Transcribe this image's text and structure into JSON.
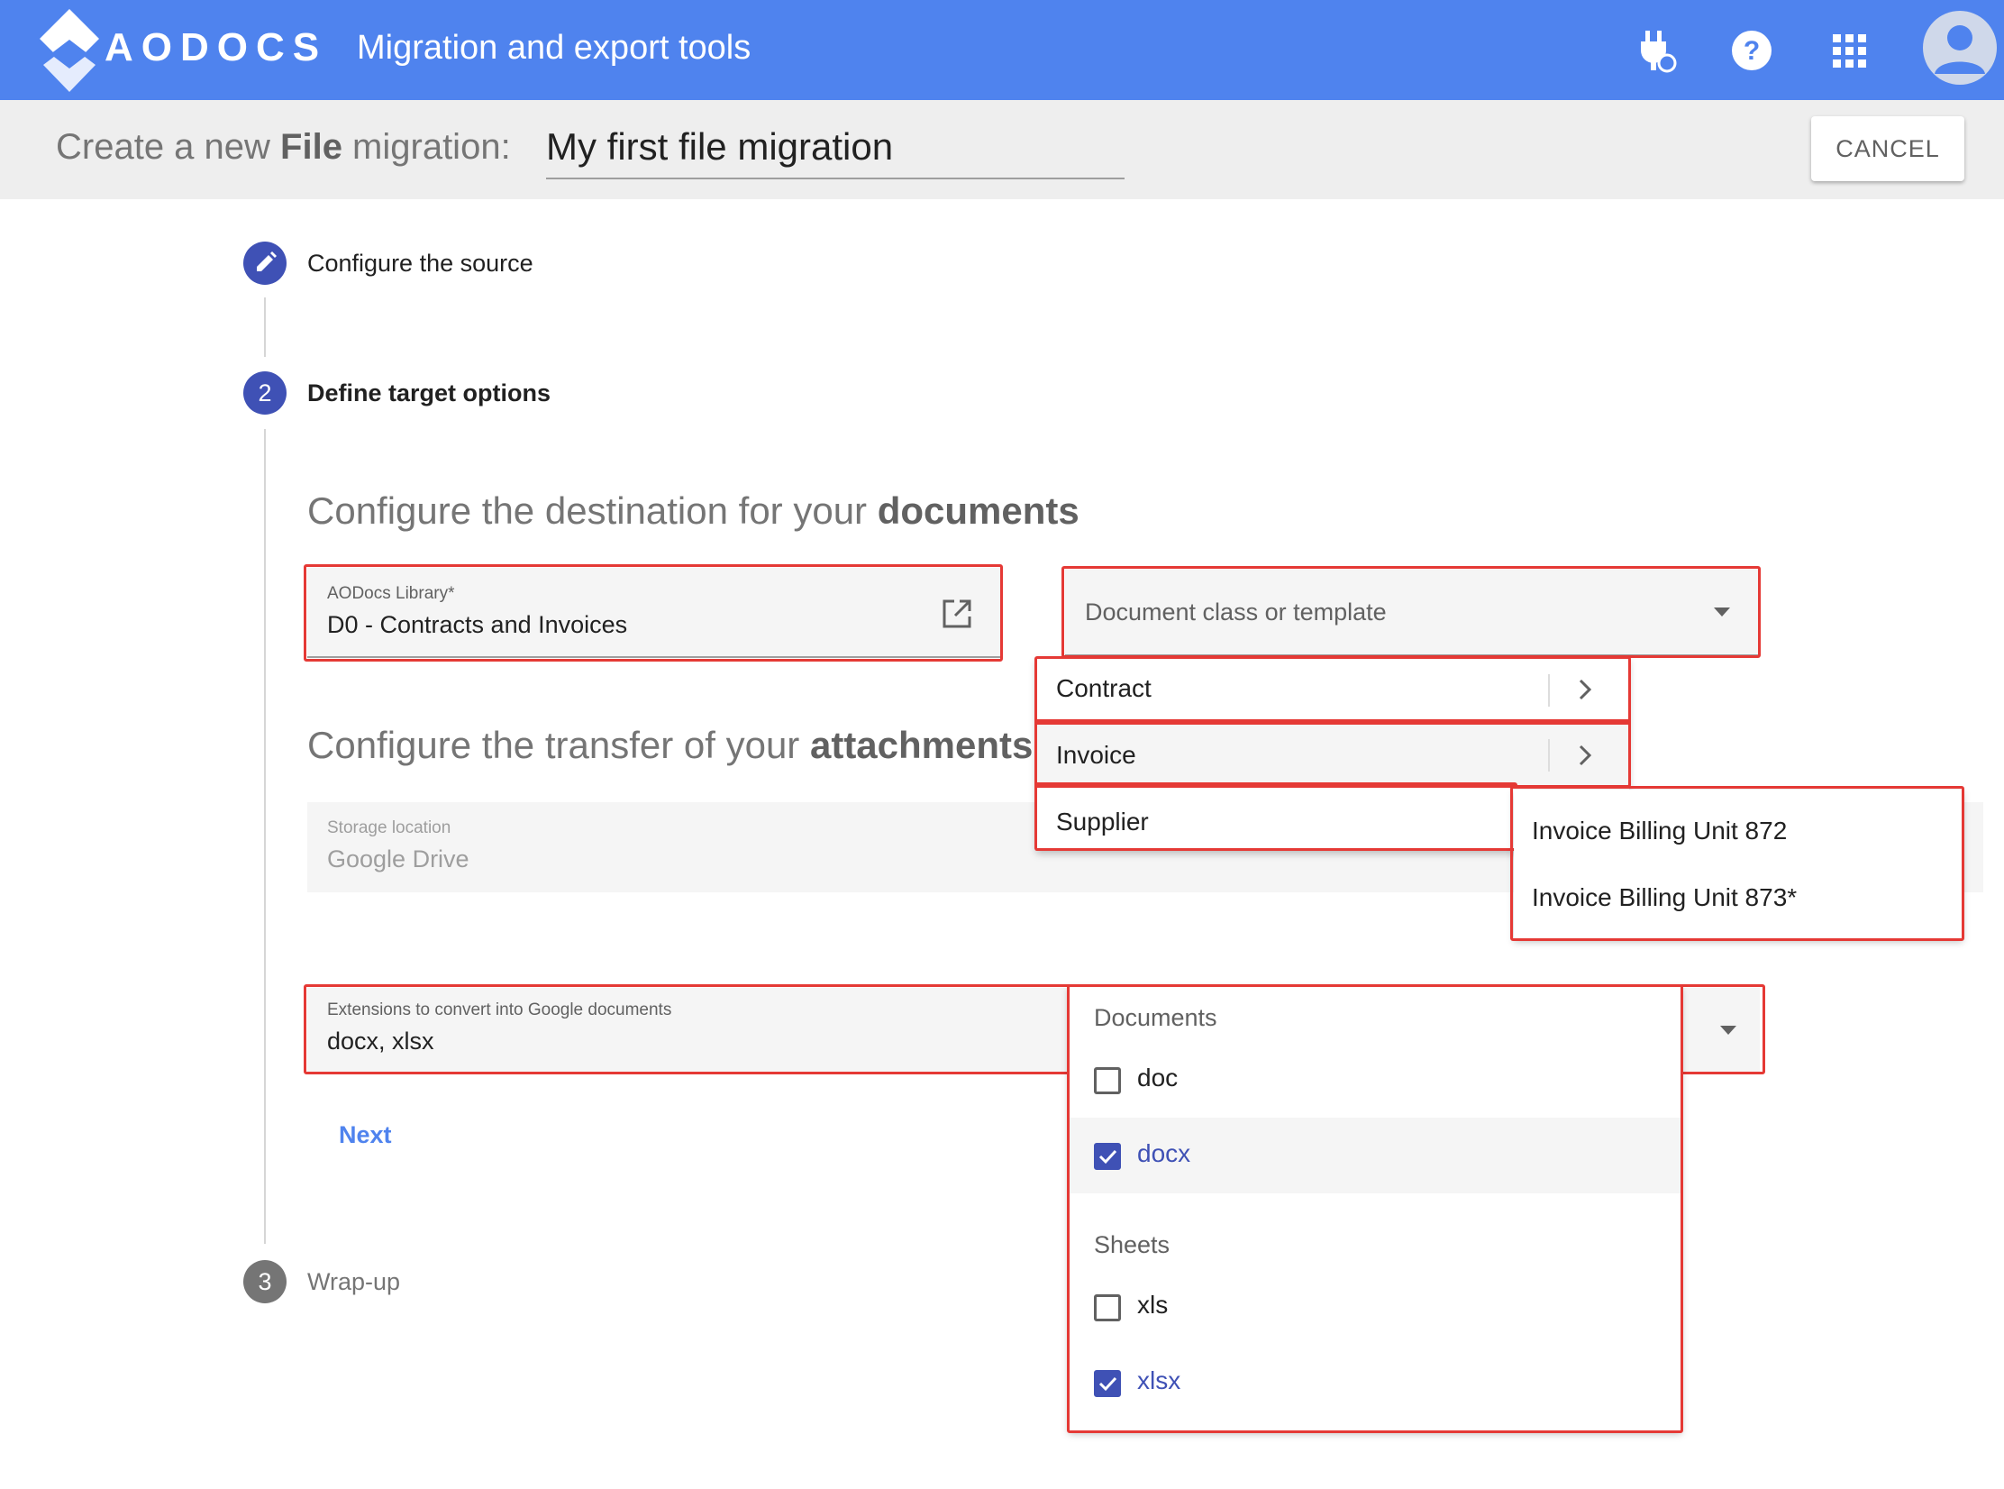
{
  "appbar": {
    "logo_text": "AODOCS",
    "title": "Migration and export tools",
    "icons": [
      "plug-refresh-icon",
      "help-icon",
      "apps-grid-icon",
      "account-avatar-icon"
    ]
  },
  "subbar": {
    "label_prefix": "Create a new ",
    "label_bold": "File",
    "label_suffix": " migration:",
    "migration_name": "My first file migration",
    "cancel": "CANCEL"
  },
  "stepper": {
    "steps": [
      {
        "number": "",
        "label": "Configure the source",
        "state": "edit"
      },
      {
        "number": "2",
        "label": "Define target options",
        "state": "active"
      },
      {
        "number": "3",
        "label": "Wrap-up",
        "state": "inactive"
      }
    ]
  },
  "documents": {
    "title_prefix": "Configure the destination for your ",
    "title_bold": "documents",
    "library_label": "AODocs Library*",
    "library_value": "D0 - Contracts and Invoices",
    "class_placeholder": "Document class or template",
    "class_menu": [
      "Contract",
      "Invoice",
      "Supplier"
    ],
    "invoice_submenu": [
      "Invoice Billing Unit 872",
      "Invoice Billing Unit 873*"
    ]
  },
  "attachments": {
    "title_prefix": "Configure the transfer of your ",
    "title_bold": "attachments",
    "storage_label": "Storage location",
    "storage_value": "Google Drive",
    "extensions_label": "Extensions to convert into Google documents",
    "extensions_value": "docx, xlsx"
  },
  "extensions_menu": {
    "groups": [
      {
        "name": "Documents",
        "options": [
          {
            "label": "doc",
            "checked": false
          },
          {
            "label": "docx",
            "checked": true
          }
        ]
      },
      {
        "name": "Sheets",
        "options": [
          {
            "label": "xls",
            "checked": false
          },
          {
            "label": "xlsx",
            "checked": true
          }
        ]
      }
    ]
  },
  "next": "Next",
  "colors": {
    "appbar": "#4f83ee",
    "stepper_active": "#3f51b5",
    "stepper_inactive": "#757575",
    "highlight": "#e53935",
    "checked": "#3f51b5"
  }
}
